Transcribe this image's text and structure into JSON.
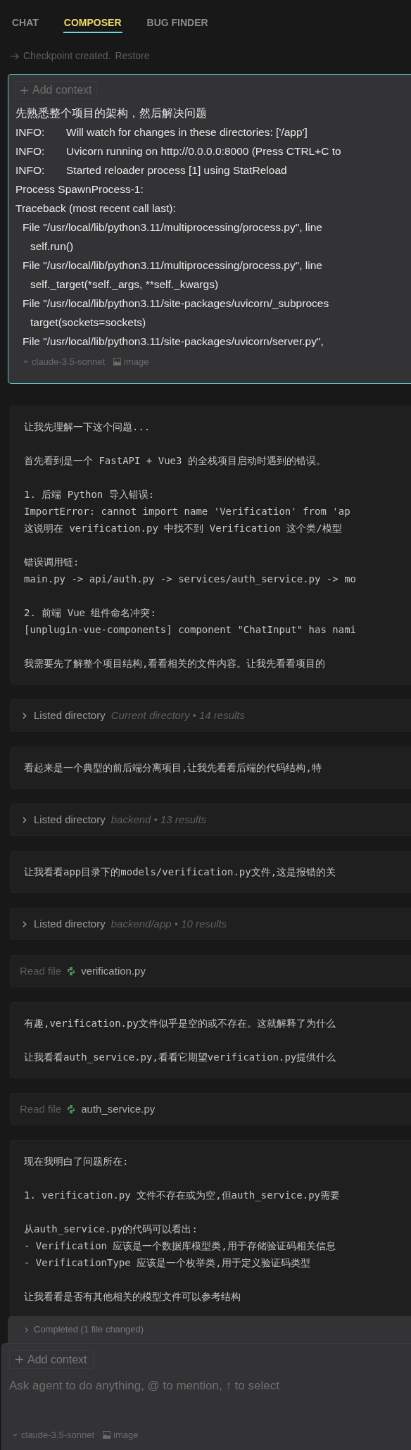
{
  "tabs": [
    {
      "label": "CHAT",
      "selected": false
    },
    {
      "label": "COMPOSER",
      "selected": true
    },
    {
      "label": "BUG FINDER",
      "selected": false
    }
  ],
  "checkpoint": {
    "text": "Checkpoint created.",
    "action": "Restore"
  },
  "composer": {
    "add_context": "Add context",
    "lines": [
      {
        "kind": "plain",
        "text": "先熟悉整个项目的架构，然后解决问题"
      },
      {
        "kind": "log",
        "level": "INFO:",
        "text": "Will watch for changes in these directories: ['/app']"
      },
      {
        "kind": "log",
        "level": "INFO:",
        "text": "Uvicorn running on http://0.0.0.0:8000 (Press CTRL+C to"
      },
      {
        "kind": "log",
        "level": "INFO:",
        "text": "Started reloader process [1] using StatReload"
      },
      {
        "kind": "plain",
        "text": "Process SpawnProcess-1:"
      },
      {
        "kind": "plain",
        "text": "Traceback (most recent call last):"
      },
      {
        "kind": "indent1",
        "text": "File \"/usr/local/lib/python3.11/multiprocessing/process.py\", line"
      },
      {
        "kind": "indent2",
        "text": "self.run()"
      },
      {
        "kind": "indent1",
        "text": "File \"/usr/local/lib/python3.11/multiprocessing/process.py\", line"
      },
      {
        "kind": "indent2",
        "text": "self._target(*self._args, **self._kwargs)"
      },
      {
        "kind": "indent1",
        "text": "File \"/usr/local/lib/python3.11/site-packages/uvicorn/_subproces"
      },
      {
        "kind": "indent2",
        "text": "target(sockets=sockets)"
      },
      {
        "kind": "indent1",
        "text": "File \"/usr/local/lib/python3.11/site-packages/uvicorn/server.py\","
      }
    ],
    "model": "claude-3.5-sonnet",
    "image": "image"
  },
  "messages": [
    {
      "kind": "text",
      "paragraphs": [
        [
          "让我先理解一下这个问题..."
        ],
        [
          "首先看到是一个 FastAPI + Vue3 的全栈项目启动时遇到的错误。"
        ],
        [
          "1. 后端 Python 导入错误:",
          "ImportError: cannot import name 'Verification' from 'ap",
          "这说明在 verification.py 中找不到 Verification 这个类/模型"
        ],
        [
          "错误调用链:",
          "main.py -> api/auth.py -> services/auth_service.py -> mo"
        ],
        [
          "2. 前端 Vue 组件命名冲突:",
          "[unplugin-vue-components] component \"ChatInput\" has nami"
        ],
        [
          "我需要先了解整个项目结构,看看相关的文件内容。让我先看看项目的"
        ]
      ]
    },
    {
      "kind": "tool",
      "action": "Listed directory",
      "detail": "Current directory • 14 results"
    },
    {
      "kind": "text",
      "paragraphs": [
        [
          "看起来是一个典型的前后端分离项目,让我先看看后端的代码结构,特"
        ]
      ]
    },
    {
      "kind": "tool",
      "action": "Listed directory",
      "detail": "backend • 13 results"
    },
    {
      "kind": "text",
      "paragraphs": [
        [
          "让我看看app目录下的models/verification.py文件,这是报错的关"
        ]
      ]
    },
    {
      "kind": "tool",
      "action": "Listed directory",
      "detail": "backend/app • 10 results"
    },
    {
      "kind": "file",
      "action": "Read file",
      "filename": "verification.py"
    },
    {
      "kind": "text",
      "paragraphs": [
        [
          "有趣,verification.py文件似乎是空的或不存在。这就解释了为什么"
        ],
        [
          "让我看看auth_service.py,看看它期望verification.py提供什么"
        ]
      ]
    },
    {
      "kind": "file",
      "action": "Read file",
      "filename": "auth_service.py"
    },
    {
      "kind": "text",
      "paragraphs": [
        [
          "现在我明白了问题所在:"
        ],
        [
          "1. verification.py 文件不存在或为空,但auth_service.py需要"
        ],
        [
          "从auth_service.py的代码可以看出:",
          "- Verification 应该是一个数据库模型类,用于存储验证码相关信息",
          "- VerificationType 应该是一个枚举类,用于定义验证码类型"
        ],
        [
          "让我看看是否有其他相关的模型文件可以参考结构"
        ]
      ]
    }
  ],
  "completed": "Completed (1 file changed)",
  "input": {
    "add_context": "Add context",
    "placeholder": "Ask agent to do anything, @ to mention, ↑ to select",
    "model": "claude-3.5-sonnet",
    "image": "image"
  }
}
